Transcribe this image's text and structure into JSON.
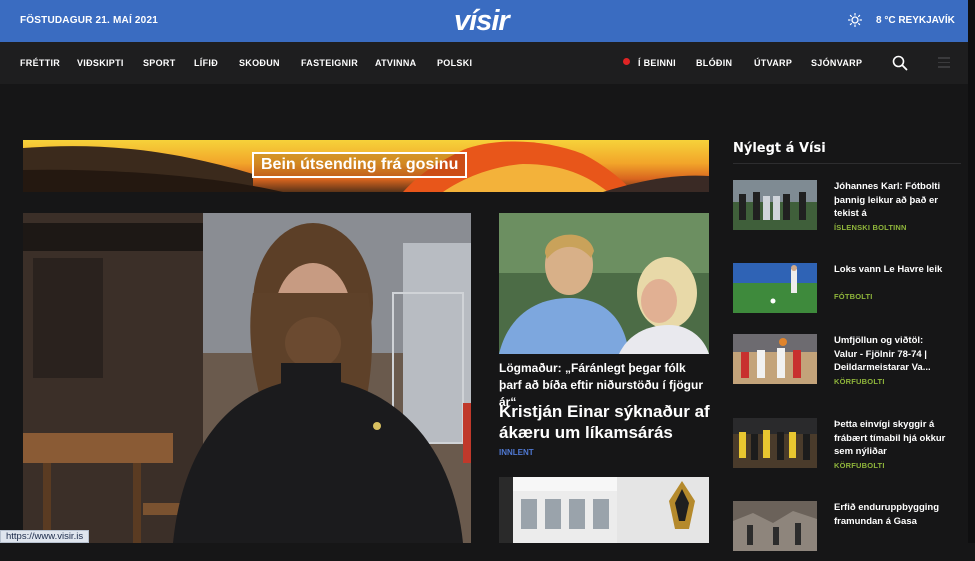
{
  "header": {
    "date": "FÖSTUDAGUR 21. MAÍ 2021",
    "logo": "vísir",
    "weather": "8 °C REYKJAVÍK",
    "brand_color": "#3a6cc1"
  },
  "nav": {
    "items": [
      "FRÉTTIR",
      "VIÐSKIPTI",
      "SPORT",
      "LÍFIÐ",
      "SKOÐUN",
      "FASTEIGNIR",
      "ATVINNA",
      "POLSKI"
    ],
    "right_items": [
      "Í BEINNI",
      "BLÓÐIN",
      "ÚTVARP",
      "SJÓNVARP"
    ]
  },
  "banner": {
    "label": "Bein útsending frá gosinu"
  },
  "story2": {
    "quote": "Lögmaður: „Fáránlegt þegar fólk þarf að bíða eftir niðurstöðu í fjögur ár“",
    "headline": "Kristján Einar sýknaður af ákæru um líkamsárás",
    "tag": "INNLENT"
  },
  "sidebar": {
    "title": "Nýlegt á Vísi",
    "items": [
      {
        "title": "Jóhannes Karl: Fótbolti þannig leikur að það er tekist á",
        "tag": "ÍSLENSKI BOLTINN"
      },
      {
        "title": "Loks vann Le Havre leik",
        "tag": "FÓTBOLTI"
      },
      {
        "title": "Umfjöllun og viðtöl: Valur - Fjölnir 78-74 | Deildarmeistarar Va...",
        "tag": "KÖRFUBOLTI"
      },
      {
        "title": "Þetta einvígi skyggir á frábært tímabil hjá okkur sem nýliðar",
        "tag": "KÖRFUBOLTI"
      },
      {
        "title": "Erfið enduruppbygging framundan á Gasa",
        "tag": ""
      }
    ]
  },
  "status_bar": {
    "url": "https://www.visir.is"
  }
}
